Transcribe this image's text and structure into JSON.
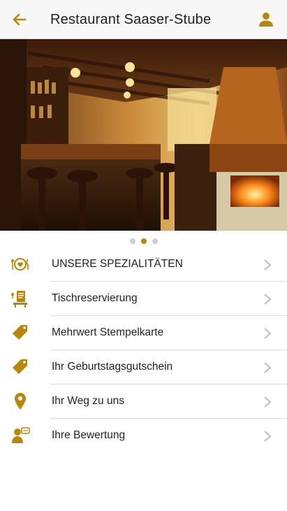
{
  "header": {
    "title": "Restaurant Saaser-Stube"
  },
  "carousel": {
    "pages": 3,
    "active": 1
  },
  "menu": {
    "items": [
      {
        "label": "UNSERE SPEZIALITÄTEN",
        "icon": "plate-cutlery-icon"
      },
      {
        "label": "Tischreservierung",
        "icon": "reservation-icon"
      },
      {
        "label": "Mehrwert Stempelkarte",
        "icon": "tag-icon"
      },
      {
        "label": "Ihr Geburtstagsgutschein",
        "icon": "tag-icon"
      },
      {
        "label": "Ihr Weg zu uns",
        "icon": "location-pin-icon"
      },
      {
        "label": "Ihre Bewertung",
        "icon": "review-icon"
      }
    ]
  },
  "colors": {
    "accent": "#b8860b",
    "chevron": "#bdbdbd"
  }
}
